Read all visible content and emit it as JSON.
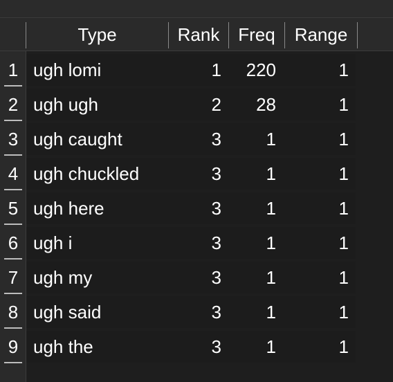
{
  "columns": {
    "type": "Type",
    "rank": "Rank",
    "freq": "Freq",
    "range": "Range"
  },
  "rows": [
    {
      "num": "1",
      "type": "ugh lomi",
      "rank": "1",
      "freq": "220",
      "range": "1"
    },
    {
      "num": "2",
      "type": "ugh ugh",
      "rank": "2",
      "freq": "28",
      "range": "1"
    },
    {
      "num": "3",
      "type": "ugh caught",
      "rank": "3",
      "freq": "1",
      "range": "1"
    },
    {
      "num": "4",
      "type": "ugh chuckled",
      "rank": "3",
      "freq": "1",
      "range": "1"
    },
    {
      "num": "5",
      "type": "ugh here",
      "rank": "3",
      "freq": "1",
      "range": "1"
    },
    {
      "num": "6",
      "type": "ugh i",
      "rank": "3",
      "freq": "1",
      "range": "1"
    },
    {
      "num": "7",
      "type": "ugh my",
      "rank": "3",
      "freq": "1",
      "range": "1"
    },
    {
      "num": "8",
      "type": "ugh said",
      "rank": "3",
      "freq": "1",
      "range": "1"
    },
    {
      "num": "9",
      "type": "ugh the",
      "rank": "3",
      "freq": "1",
      "range": "1"
    }
  ]
}
